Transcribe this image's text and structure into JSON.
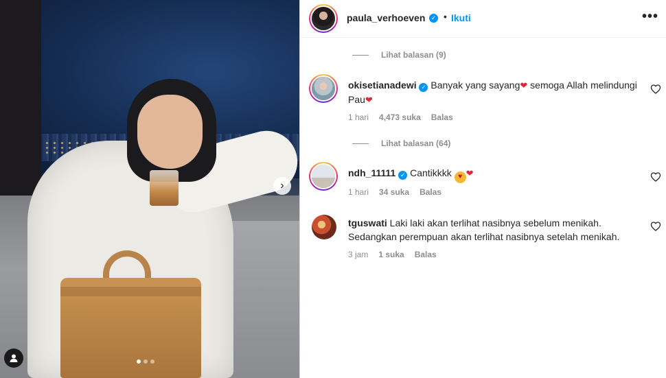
{
  "post": {
    "photo_dots": 3,
    "active_dot": 1,
    "next_icon": "chevron-right-icon",
    "tag_icon": "user-tag-icon"
  },
  "header": {
    "username": "paula_verhoeven",
    "separator": "•",
    "follow_label": "Ikuti",
    "more_label": "•••"
  },
  "threads": [
    {
      "view_replies": "Lihat balasan (9)"
    },
    {
      "view_replies": "Lihat balasan (64)"
    }
  ],
  "comments": [
    {
      "username": "okisetianadewi",
      "verified": true,
      "text_part1": "Banyak yang sayang",
      "text_part2": " semoga Allah melindungi Pau",
      "time": "1 hari",
      "likes": "4,473 suka",
      "reply": "Balas"
    },
    {
      "username": "ndh_11111",
      "verified": true,
      "text": "Cantikkkk",
      "time": "1 hari",
      "likes": "34 suka",
      "reply": "Balas"
    },
    {
      "username": "tguswati",
      "verified": false,
      "text": "Laki laki akan terlihat nasibnya sebelum menikah. Sedangkan perempuan akan terlihat nasibnya setelah menikah.",
      "time": "3 jam",
      "likes": "1 suka",
      "reply": "Balas"
    }
  ],
  "colors": {
    "link_blue": "#0095f6",
    "muted": "#8e8e8e",
    "heart_red": "#e0243a"
  }
}
